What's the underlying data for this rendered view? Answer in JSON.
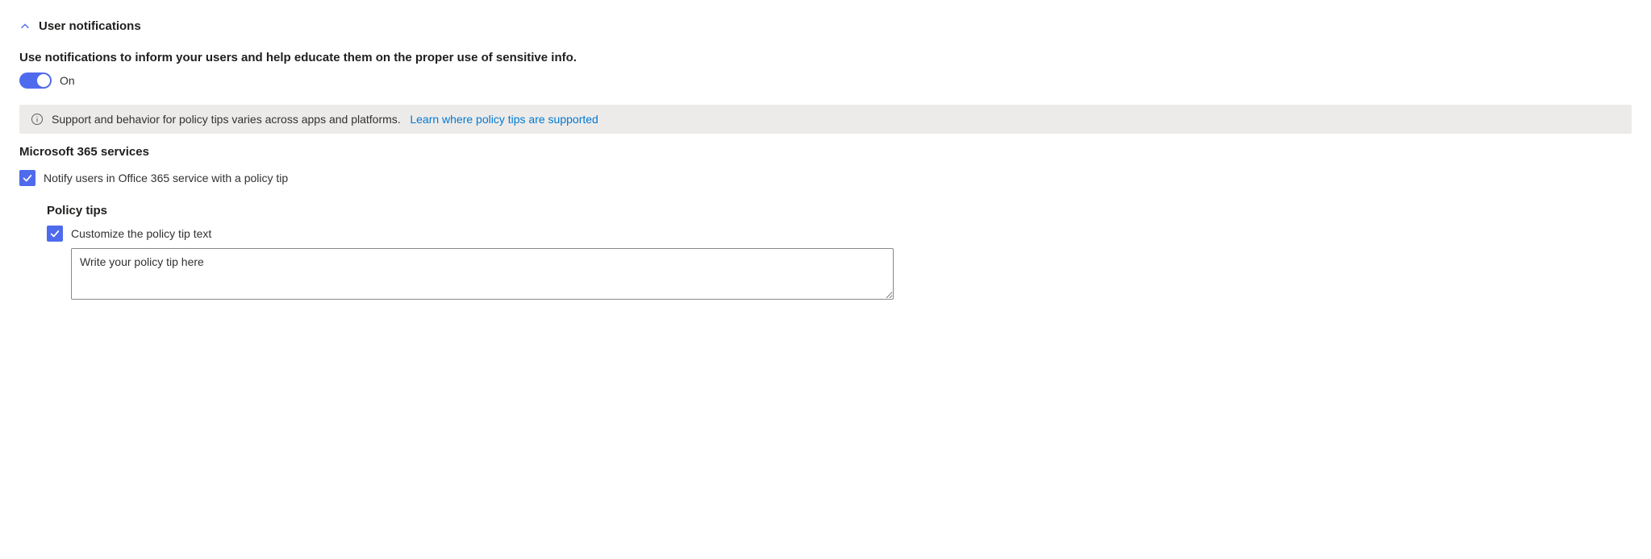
{
  "section": {
    "title": "User notifications",
    "description": "Use notifications to inform your users and help educate them on the proper use of sensitive info.",
    "toggle_label": "On",
    "toggle_on": true
  },
  "info_banner": {
    "text": "Support and behavior for policy tips varies across apps and platforms.",
    "link_text": "Learn where policy tips are supported"
  },
  "m365": {
    "title": "Microsoft 365 services",
    "notify_label": "Notify users in Office 365 service with a policy tip",
    "notify_checked": true
  },
  "policy_tips": {
    "title": "Policy tips",
    "customize_label": "Customize the policy tip text",
    "customize_checked": true,
    "textarea_value": "Write your policy tip here"
  },
  "colors": {
    "accent": "#4f6bed",
    "link": "#0078d4",
    "banner_bg": "#edebe9"
  }
}
